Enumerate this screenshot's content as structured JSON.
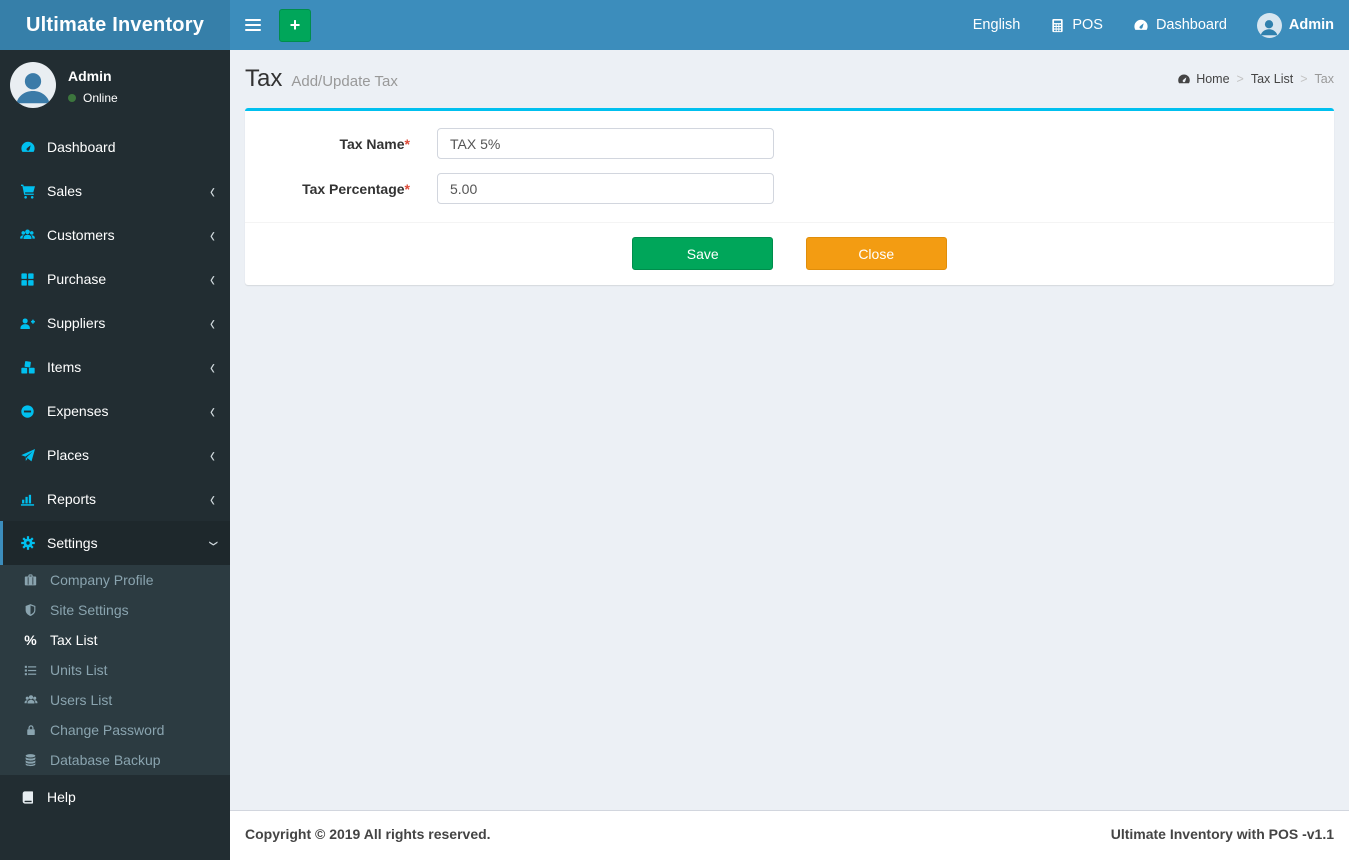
{
  "app": {
    "title": "Ultimate Inventory",
    "copyright": "Copyright © 2019 All rights reserved.",
    "version_label": "Ultimate Inventory with POS -v1.1"
  },
  "navbar": {
    "add_button": "+",
    "items": [
      {
        "label": "English"
      },
      {
        "label": "POS",
        "icon": "calculator-icon"
      },
      {
        "label": "Dashboard",
        "icon": "tachometer-icon"
      },
      {
        "label": "Admin",
        "icon": "avatar"
      }
    ]
  },
  "user_panel": {
    "name": "Admin",
    "status": "Online"
  },
  "sidebar": {
    "items": [
      {
        "label": "Dashboard",
        "icon": "tachometer-icon",
        "expandable": false
      },
      {
        "label": "Sales",
        "icon": "cart-icon",
        "expandable": true
      },
      {
        "label": "Customers",
        "icon": "users-icon",
        "expandable": true
      },
      {
        "label": "Purchase",
        "icon": "grid-icon",
        "expandable": true
      },
      {
        "label": "Suppliers",
        "icon": "user-plus-icon",
        "expandable": true
      },
      {
        "label": "Items",
        "icon": "cubes-icon",
        "expandable": true
      },
      {
        "label": "Expenses",
        "icon": "minus-circle-icon",
        "expandable": true
      },
      {
        "label": "Places",
        "icon": "paper-plane-icon",
        "expandable": true
      },
      {
        "label": "Reports",
        "icon": "bar-chart-icon",
        "expandable": true
      },
      {
        "label": "Settings",
        "icon": "gears-icon",
        "expandable": true,
        "state": "open"
      },
      {
        "label": "Help",
        "icon": "book-icon",
        "expandable": false
      }
    ],
    "settings_submenu": [
      {
        "label": "Company Profile",
        "icon": "briefcase-icon"
      },
      {
        "label": "Site Settings",
        "icon": "shield-icon"
      },
      {
        "label": "Tax List",
        "icon": "percent-icon",
        "active": true
      },
      {
        "label": "Units List",
        "icon": "list-icon"
      },
      {
        "label": "Users List",
        "icon": "users-icon"
      },
      {
        "label": "Change Password",
        "icon": "lock-icon"
      },
      {
        "label": "Database Backup",
        "icon": "database-icon"
      }
    ],
    "percent_glyph": "%"
  },
  "page": {
    "title": "Tax",
    "subtitle": "Add/Update Tax",
    "breadcrumb": [
      "Home",
      "Tax List",
      "Tax"
    ],
    "breadcrumb_separator": ">"
  },
  "form": {
    "required_mark": "*",
    "fields": [
      {
        "label": "Tax Name",
        "value": "TAX 5%"
      },
      {
        "label": "Tax Percentage",
        "value": "5.00"
      }
    ],
    "save_label": "Save",
    "close_label": "Close"
  },
  "colors": {
    "navbar": "#3c8dbc",
    "logo_bg": "#367fa9",
    "sidebar_bg": "#222d32",
    "submenu_bg": "#2c3b41",
    "active_row_bg": "#1e282c",
    "sidebar_icon": "#00c0ef",
    "panel_accent": "#00c0ef",
    "save_green": "#00a65a",
    "close_orange": "#f39c12",
    "content_bg": "#ecf0f5",
    "online_dot": "#3c763d"
  }
}
